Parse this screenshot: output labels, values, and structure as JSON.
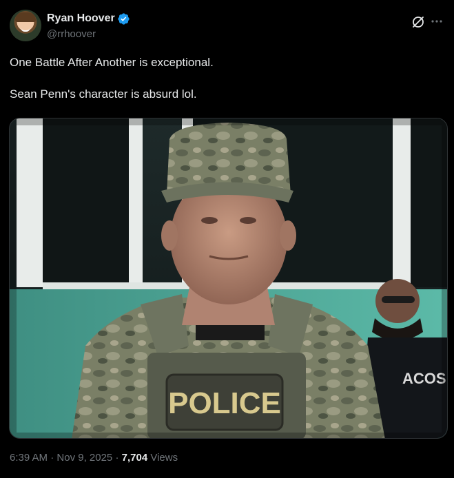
{
  "author": {
    "display_name": "Ryan Hoover",
    "handle": "@rrhoover",
    "verified": true,
    "verified_color": "#1d9bf0"
  },
  "icons": {
    "verified": "verified-badge-icon",
    "grok": "grok-icon",
    "more": "more-options-icon"
  },
  "tweet": {
    "lines": [
      "One Battle After Another is exceptional.",
      "Sean Penn's character is absurd lol."
    ],
    "image": {
      "subject": "photo",
      "patch_text": "POLICE",
      "shirt_text": "ACOS"
    }
  },
  "meta": {
    "time": "6:39 AM",
    "separator": "·",
    "date": "Nov 9, 2025",
    "views_count": "7,704",
    "views_label": "Views"
  },
  "colors": {
    "background": "#000000",
    "text_primary": "#e7e9ea",
    "text_secondary": "#71767b",
    "border": "#2f3336"
  }
}
